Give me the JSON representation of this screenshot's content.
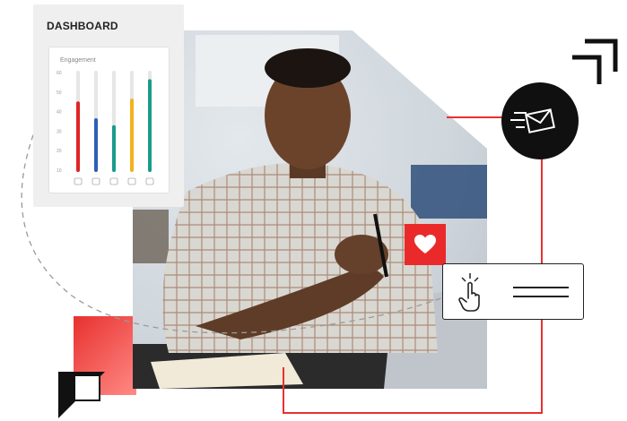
{
  "dashboard": {
    "title": "DASHBOARD",
    "subtitle": "Engagement",
    "y_ticks": [
      "60",
      "50",
      "40",
      "30",
      "20",
      "10"
    ],
    "bars": [
      {
        "value": 48,
        "color": "#e02424"
      },
      {
        "value": 36,
        "color": "#2b5fb8"
      },
      {
        "value": 31,
        "color": "#1a9b8a"
      },
      {
        "value": 50,
        "color": "#f2b21b"
      },
      {
        "value": 64,
        "color": "#1a9b8a"
      }
    ],
    "bar_max": 70,
    "bottom_icons": [
      "document-icon",
      "mail-icon",
      "globe-icon",
      "monitor-icon",
      "phone-icon"
    ]
  },
  "colors": {
    "accent_red": "#e8312f",
    "black": "#101010",
    "navy": "#1e3a5f"
  },
  "icons": {
    "mail": "mail-icon",
    "heart": "heart-icon",
    "touch": "touch-icon",
    "corner": "corner-bracket-icon"
  }
}
